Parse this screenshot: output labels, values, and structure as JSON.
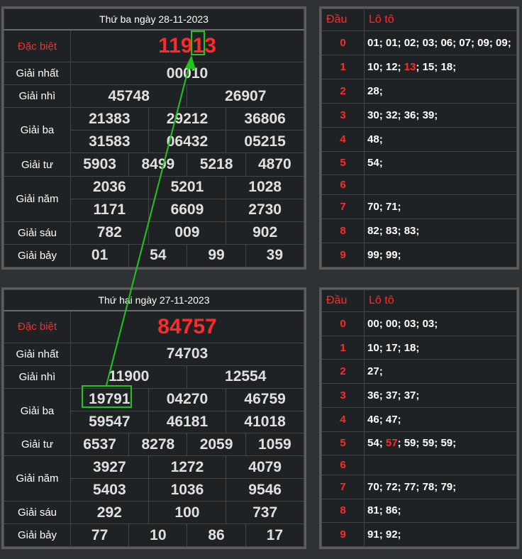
{
  "top": {
    "title": "Thứ ba ngày 28-11-2023",
    "special": "11913",
    "prizes": [
      {
        "label": "Giải nhất",
        "rows": [
          [
            "00010"
          ]
        ]
      },
      {
        "label": "Giải nhì",
        "rows": [
          [
            "45748",
            "26907"
          ]
        ]
      },
      {
        "label": "Giải ba",
        "rows": [
          [
            "21383",
            "29212",
            "36806"
          ],
          [
            "31583",
            "06432",
            "05215"
          ]
        ]
      },
      {
        "label": "Giải tư",
        "rows": [
          [
            "5903",
            "8499",
            "5218",
            "4870"
          ]
        ]
      },
      {
        "label": "Giải năm",
        "rows": [
          [
            "2036",
            "5201",
            "1028"
          ],
          [
            "1171",
            "6609",
            "2730"
          ]
        ]
      },
      {
        "label": "Giải sáu",
        "rows": [
          [
            "782",
            "009",
            "902"
          ]
        ]
      },
      {
        "label": "Giải bảy",
        "rows": [
          [
            "01",
            "54",
            "99",
            "39"
          ]
        ]
      }
    ],
    "loto": [
      {
        "dau": "0",
        "items": [
          "01",
          "01",
          "02",
          "03",
          "06",
          "07",
          "09",
          "09"
        ]
      },
      {
        "dau": "1",
        "items": [
          "10",
          "12",
          "13",
          "15",
          "18"
        ],
        "highlight": "13"
      },
      {
        "dau": "2",
        "items": [
          "28"
        ]
      },
      {
        "dau": "3",
        "items": [
          "30",
          "32",
          "36",
          "39"
        ]
      },
      {
        "dau": "4",
        "items": [
          "48"
        ]
      },
      {
        "dau": "5",
        "items": [
          "54"
        ]
      },
      {
        "dau": "6",
        "items": []
      },
      {
        "dau": "7",
        "items": [
          "70",
          "71"
        ]
      },
      {
        "dau": "8",
        "items": [
          "82",
          "83",
          "83"
        ]
      },
      {
        "dau": "9",
        "items": [
          "99",
          "99"
        ]
      }
    ]
  },
  "bottom": {
    "title": "Thứ hai ngày 27-11-2023",
    "special": "84757",
    "prizes": [
      {
        "label": "Giải nhất",
        "rows": [
          [
            "74703"
          ]
        ]
      },
      {
        "label": "Giải nhì",
        "rows": [
          [
            "11900",
            "12554"
          ]
        ]
      },
      {
        "label": "Giải ba",
        "rows": [
          [
            "19791",
            "04270",
            "46759"
          ],
          [
            "59547",
            "46181",
            "41018"
          ]
        ]
      },
      {
        "label": "Giải tư",
        "rows": [
          [
            "6537",
            "8278",
            "2059",
            "1059"
          ]
        ]
      },
      {
        "label": "Giải năm",
        "rows": [
          [
            "3927",
            "1272",
            "4079"
          ],
          [
            "5403",
            "1036",
            "9546"
          ]
        ]
      },
      {
        "label": "Giải sáu",
        "rows": [
          [
            "292",
            "100",
            "737"
          ]
        ]
      },
      {
        "label": "Giải bảy",
        "rows": [
          [
            "77",
            "10",
            "86",
            "17"
          ]
        ]
      }
    ],
    "loto": [
      {
        "dau": "0",
        "items": [
          "00",
          "00",
          "03",
          "03"
        ]
      },
      {
        "dau": "1",
        "items": [
          "10",
          "17",
          "18"
        ]
      },
      {
        "dau": "2",
        "items": [
          "27"
        ]
      },
      {
        "dau": "3",
        "items": [
          "36",
          "37",
          "37"
        ]
      },
      {
        "dau": "4",
        "items": [
          "46",
          "47"
        ]
      },
      {
        "dau": "5",
        "items": [
          "54",
          "57",
          "59",
          "59",
          "59"
        ],
        "highlight": "57"
      },
      {
        "dau": "6",
        "items": []
      },
      {
        "dau": "7",
        "items": [
          "70",
          "72",
          "77",
          "78",
          "79"
        ]
      },
      {
        "dau": "8",
        "items": [
          "81",
          "86"
        ]
      },
      {
        "dau": "9",
        "items": [
          "91",
          "92"
        ]
      }
    ]
  },
  "labels": {
    "special": "Đặc biệt",
    "dau": "Đầu",
    "loto": "Lô tô"
  },
  "colors": {
    "accent_red": "#ff2a2a",
    "highlight_green": "#22c51a",
    "panel_bg": "#1f2224",
    "page_bg": "#2f3234"
  }
}
